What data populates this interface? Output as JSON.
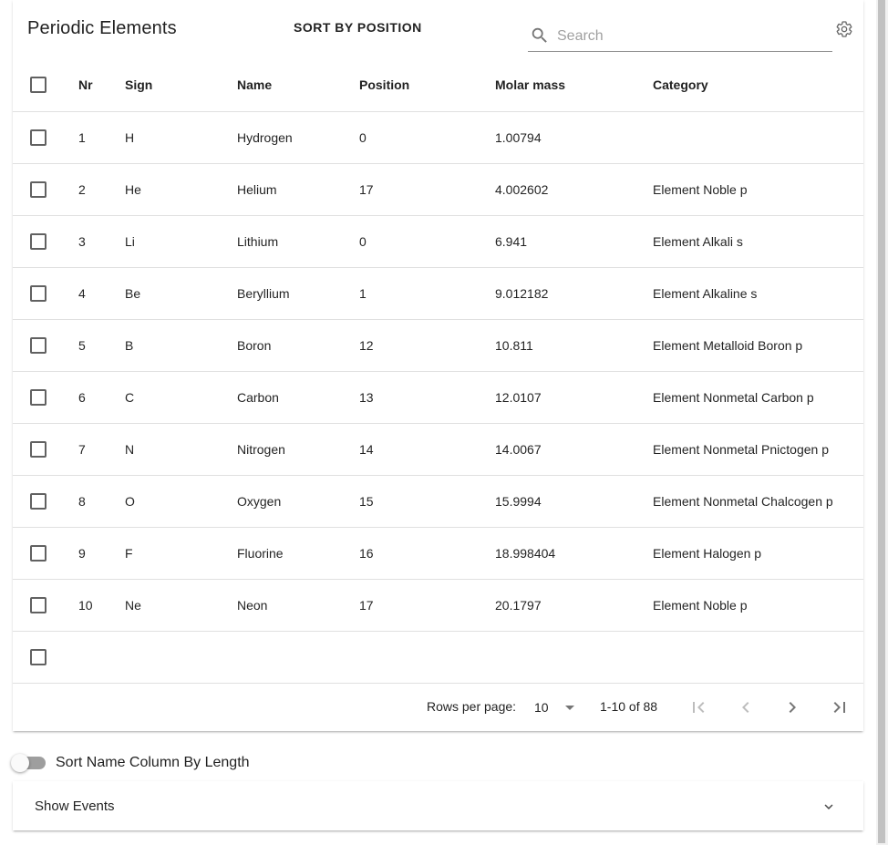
{
  "header": {
    "title": "Periodic Elements",
    "sort_button": "SORT BY POSITION",
    "search_placeholder": "Search",
    "settings_icon": "gear-icon"
  },
  "table": {
    "columns": [
      "Nr",
      "Sign",
      "Name",
      "Position",
      "Molar mass",
      "Category"
    ],
    "rows": [
      {
        "nr": "1",
        "sign": "H",
        "name": "Hydrogen",
        "position": "0",
        "mass": "1.00794",
        "category": ""
      },
      {
        "nr": "2",
        "sign": "He",
        "name": "Helium",
        "position": "17",
        "mass": "4.002602",
        "category": "Element Noble p"
      },
      {
        "nr": "3",
        "sign": "Li",
        "name": "Lithium",
        "position": "0",
        "mass": "6.941",
        "category": "Element Alkali s"
      },
      {
        "nr": "4",
        "sign": "Be",
        "name": "Beryllium",
        "position": "1",
        "mass": "9.012182",
        "category": "Element Alkaline s"
      },
      {
        "nr": "5",
        "sign": "B",
        "name": "Boron",
        "position": "12",
        "mass": "10.811",
        "category": "Element Metalloid Boron p"
      },
      {
        "nr": "6",
        "sign": "C",
        "name": "Carbon",
        "position": "13",
        "mass": "12.0107",
        "category": "Element Nonmetal Carbon p"
      },
      {
        "nr": "7",
        "sign": "N",
        "name": "Nitrogen",
        "position": "14",
        "mass": "14.0067",
        "category": "Element Nonmetal Pnictogen p"
      },
      {
        "nr": "8",
        "sign": "O",
        "name": "Oxygen",
        "position": "15",
        "mass": "15.9994",
        "category": "Element Nonmetal Chalcogen p"
      },
      {
        "nr": "9",
        "sign": "F",
        "name": "Fluorine",
        "position": "16",
        "mass": "18.998404",
        "category": "Element Halogen p"
      },
      {
        "nr": "10",
        "sign": "Ne",
        "name": "Neon",
        "position": "17",
        "mass": "20.1797",
        "category": "Element Noble p"
      },
      {
        "nr": "",
        "sign": "",
        "name": "",
        "position": "",
        "mass": "",
        "category": ""
      }
    ]
  },
  "paginator": {
    "rows_per_page_label": "Rows per page:",
    "rows_per_page_value": "10",
    "range_label": "1-10 of 88"
  },
  "toggle": {
    "label": "Sort Name Column By Length",
    "checked": false
  },
  "events_panel": {
    "label": "Show Events"
  }
}
